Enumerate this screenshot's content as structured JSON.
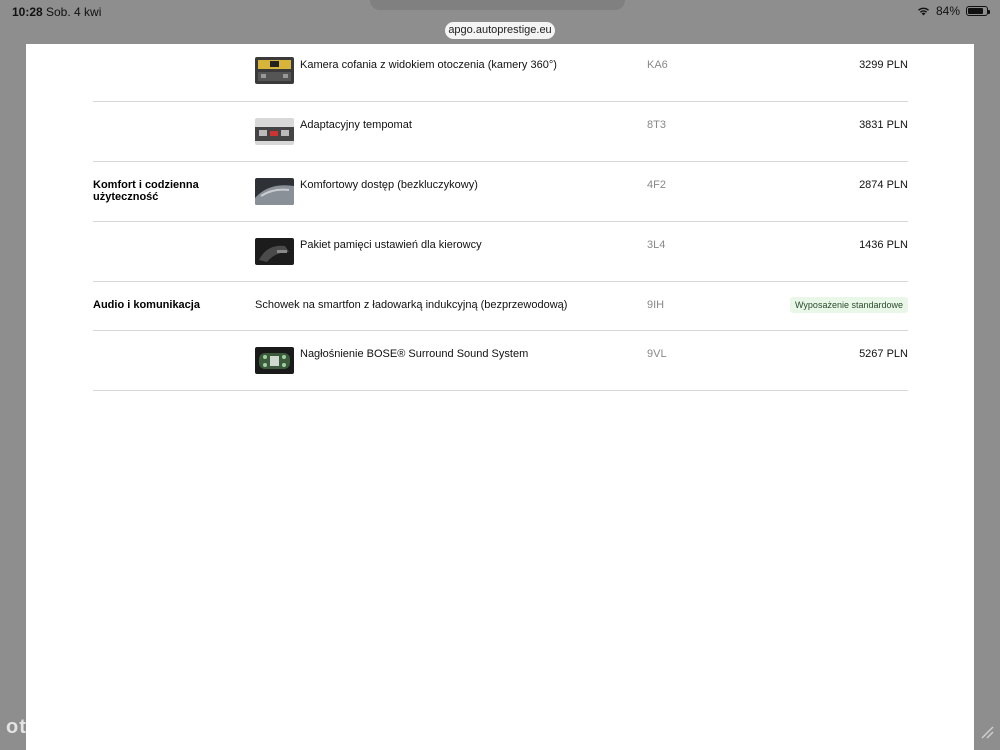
{
  "status_bar": {
    "time": "10:28",
    "date": "Sob. 4 kwi",
    "battery": "84%",
    "battery_level": 0.84,
    "wifi_icon": "wifi-icon",
    "battery_icon": "battery-icon"
  },
  "browser": {
    "url": "apgo.autoprestige.eu"
  },
  "options": [
    {
      "category": "",
      "label": "Kamera cofania z widokiem otoczenia (kamery 360°)",
      "code": "KA6",
      "price": "3299 PLN",
      "thumb": "camera-thumbnail"
    },
    {
      "category": "",
      "label": "Adaptacyjny tempomat",
      "code": "8T3",
      "price": "3831 PLN",
      "thumb": "cruise-control-thumbnail"
    },
    {
      "category": "Komfort i codzienna użyteczność",
      "label": "Komfortowy dostęp (bezkluczykowy)",
      "code": "4F2",
      "price": "2874 PLN",
      "thumb": "keyless-thumbnail"
    },
    {
      "category": "",
      "label": "Pakiet pamięci ustawień dla kierowcy",
      "code": "3L4",
      "price": "1436 PLN",
      "thumb": "memory-seat-thumbnail"
    },
    {
      "category": "Audio i komunikacja",
      "label": "Schowek na smartfon z ładowarką indukcyjną (bezprzewodową)",
      "code": "9IH",
      "badge": "Wyposażenie standardowe"
    },
    {
      "category": "",
      "label": "Nagłośnienie BOSE® Surround Sound System",
      "code": "9VL",
      "price": "5267 PLN",
      "thumb": "bose-thumbnail"
    }
  ],
  "watermark": "otomoto",
  "colors": {
    "badge_bg": "#e9f7e9",
    "code_gray": "#888888",
    "divider": "#d8d8d8"
  }
}
